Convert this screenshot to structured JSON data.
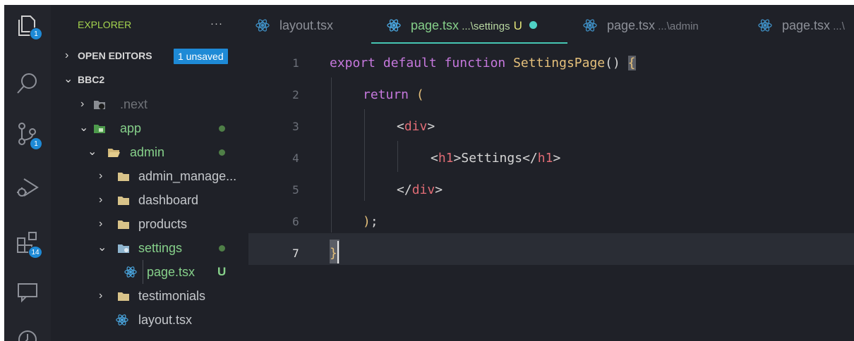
{
  "activity_bar": {
    "items": [
      {
        "icon": "files-icon",
        "badge": "1"
      },
      {
        "icon": "search-icon",
        "badge": ""
      },
      {
        "icon": "source-control-icon",
        "badge": "1"
      },
      {
        "icon": "run-debug-icon",
        "badge": ""
      },
      {
        "icon": "extensions-icon",
        "badge": "14"
      },
      {
        "icon": "remote-explorer-icon",
        "badge": ""
      },
      {
        "icon": "timeline-icon",
        "badge": ""
      }
    ]
  },
  "sidebar": {
    "title": "EXPLORER",
    "more": "···",
    "open_editors": {
      "label": "OPEN EDITORS",
      "badge": "1 unsaved"
    },
    "project": "BBC2",
    "tree": [
      {
        "label": ".next",
        "twistie": "›",
        "icon": "folder-next-icon"
      },
      {
        "label": "app",
        "twistie": "⌄",
        "icon": "folder-app-icon"
      },
      {
        "label": "admin",
        "twistie": "⌄",
        "icon": "folder-open-icon"
      },
      {
        "label": "admin_manage...",
        "twistie": "›",
        "icon": "folder-icon"
      },
      {
        "label": "dashboard",
        "twistie": "›",
        "icon": "folder-icon"
      },
      {
        "label": "products",
        "twistie": "›",
        "icon": "folder-icon"
      },
      {
        "label": "settings",
        "twistie": "⌄",
        "icon": "folder-settings-icon"
      },
      {
        "label": "page.tsx",
        "status": "U",
        "icon": "react-icon"
      },
      {
        "label": "testimonials",
        "twistie": "›",
        "icon": "folder-icon"
      },
      {
        "label": "layout.tsx",
        "icon": "react-icon"
      }
    ]
  },
  "tabs": [
    {
      "name": "layout.tsx",
      "path": ""
    },
    {
      "name": "page.tsx",
      "path": " ...\\settings",
      "status": "U"
    },
    {
      "name": "page.tsx",
      "path": " ...\\admin"
    },
    {
      "name": "page.tsx",
      "path": " ...\\"
    }
  ],
  "code": {
    "line_numbers": [
      "1",
      "2",
      "3",
      "4",
      "5",
      "6",
      "7"
    ],
    "lines": [
      {
        "kw": "export default function ",
        "fn": "SettingsPage",
        "p": "() ",
        "brace": "{"
      },
      {
        "kw": "return",
        "p": " ("
      },
      {
        "lt": "<",
        "tag": "div",
        "gt": ">"
      },
      {
        "lt": "<",
        "tag": "h1",
        "text": ">Settings</",
        "tag2": "h1",
        "gt": ">"
      },
      {
        "lt": "</",
        "tag": "div",
        "gt": ">"
      },
      {
        "paren": ")",
        "p": ";"
      },
      {
        "brace": "}"
      }
    ]
  },
  "colors": {
    "background": "#1f2128",
    "accent": "#1e8ad6",
    "explorer_title": "#a5d44e",
    "active_tab_underline": "#46c6b3",
    "keyword": "#c678dd",
    "function": "#e5c07b",
    "tag": "#e06c75"
  }
}
